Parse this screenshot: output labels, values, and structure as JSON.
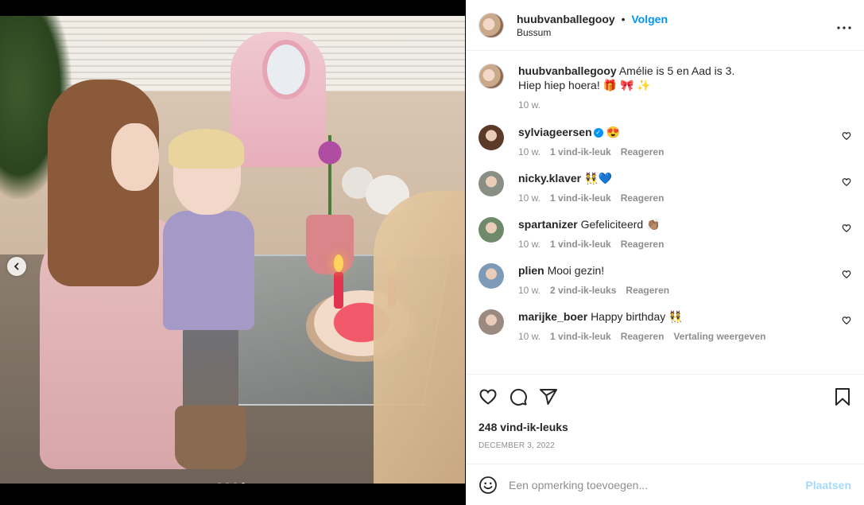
{
  "media": {
    "nav_prev_icon": "chevron-left-icon",
    "carousel_total": 4,
    "carousel_active_index": 3
  },
  "post": {
    "username": "huubvanballegooy",
    "follow_label": "Volgen",
    "location": "Bussum",
    "separator": "•",
    "avatar_color": "#c9a98a"
  },
  "caption": {
    "username": "huubvanballegooy",
    "line1": "Amélie is 5 en Aad is 3.",
    "line2": "Hiep hiep hoera! 🎁 🎀 ✨",
    "time": "10 w."
  },
  "comments": [
    {
      "username": "sylviageersen",
      "verified": true,
      "text": "😍",
      "time": "10 w.",
      "likes": "1 vind-ik-leuk",
      "reply": "Reageren",
      "avatar_color": "#5b3a2a"
    },
    {
      "username": "nicky.klaver",
      "verified": false,
      "text": "👯💙",
      "time": "10 w.",
      "likes": "1 vind-ik-leuk",
      "reply": "Reageren",
      "avatar_color": "#8a8f86"
    },
    {
      "username": "spartanizer",
      "verified": false,
      "text": "Gefeliciteerd 👏🏽",
      "time": "10 w.",
      "likes": "1 vind-ik-leuk",
      "reply": "Reageren",
      "avatar_color": "#6f8a6a"
    },
    {
      "username": "plien",
      "verified": false,
      "text": "Mooi gezin!",
      "time": "10 w.",
      "likes": "2 vind-ik-leuks",
      "reply": "Reageren",
      "avatar_color": "#7d9ab8"
    },
    {
      "username": "marijke_boer",
      "verified": false,
      "text": "Happy birthday 👯",
      "time": "10 w.",
      "likes": "1 vind-ik-leuk",
      "reply": "Reageren",
      "translate": "Vertaling weergeven",
      "avatar_color": "#9a8a80"
    }
  ],
  "actions": {
    "likes_count": "248 vind-ik-leuks",
    "date": "DECEMBER 3, 2022"
  },
  "add_comment": {
    "placeholder": "Een opmerking toevoegen...",
    "post_label": "Plaatsen"
  },
  "colors": {
    "accent": "#0095f6",
    "muted": "#8e8e8e",
    "text": "#262626"
  }
}
